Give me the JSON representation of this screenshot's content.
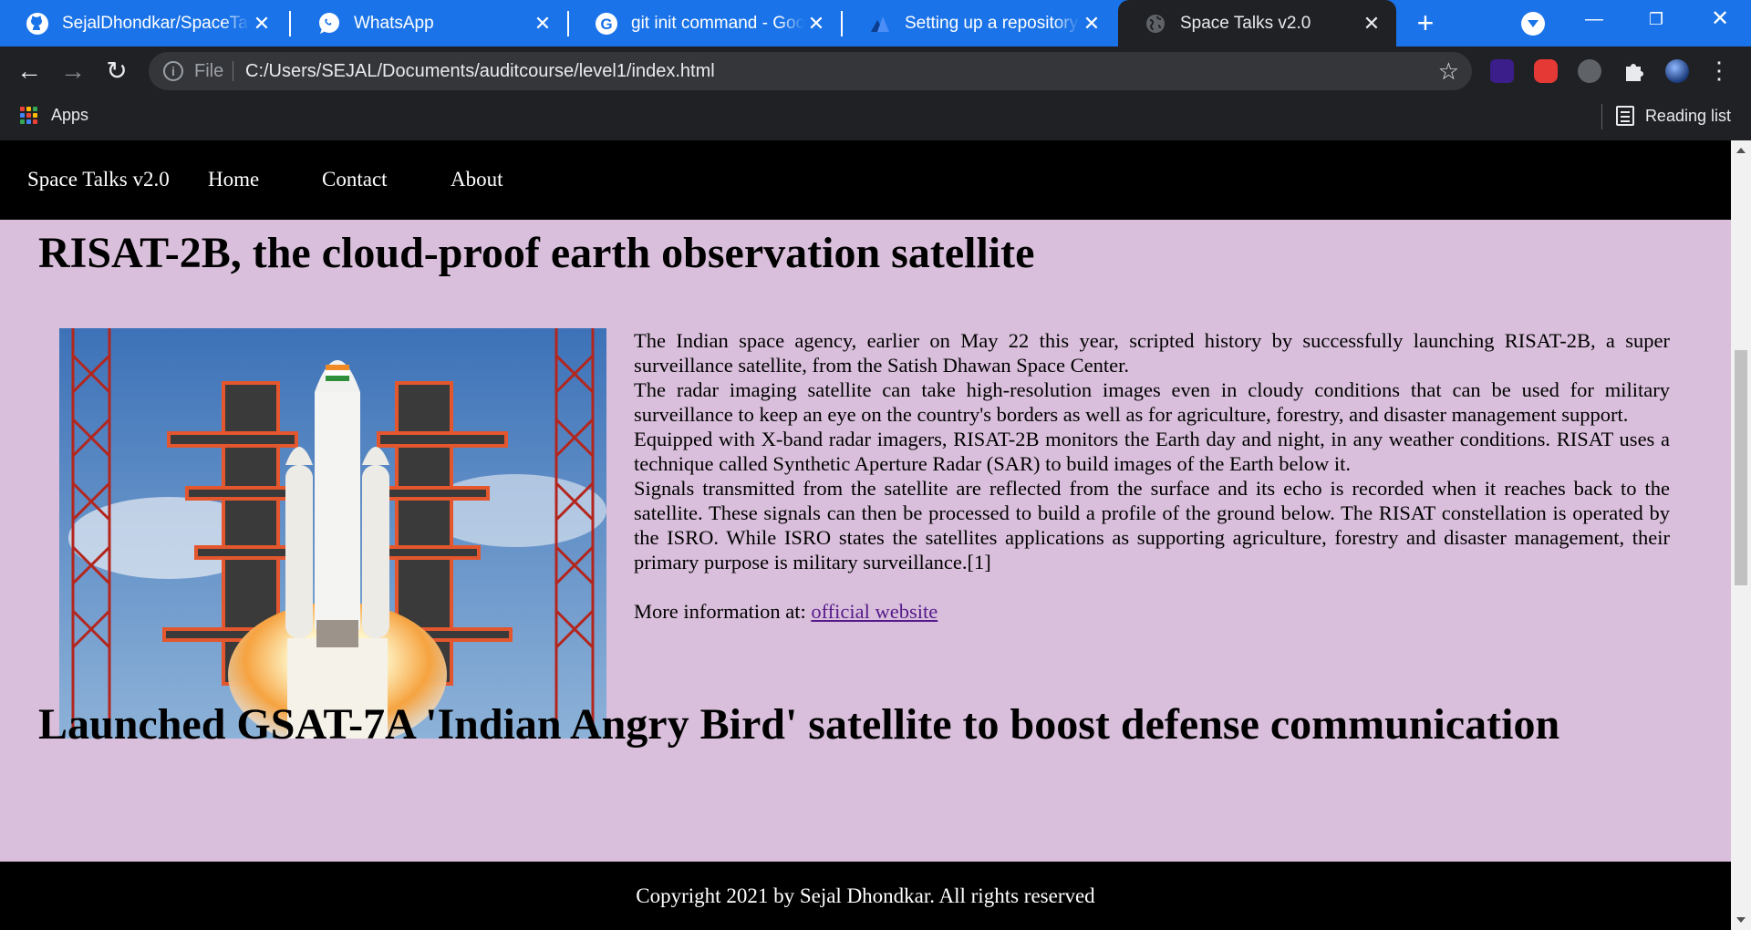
{
  "browser": {
    "tabs": [
      {
        "title": "SejalDhondkar/SpaceTalks",
        "icon": "github-icon"
      },
      {
        "title": "WhatsApp",
        "icon": "whatsapp-icon"
      },
      {
        "title": "git init command - Google Search",
        "icon": "google-icon"
      },
      {
        "title": "Setting up a repository | Atlassian",
        "icon": "atlassian-icon"
      },
      {
        "title": "Space Talks v2.0",
        "icon": "globe-icon",
        "active": true
      }
    ],
    "address": {
      "scheme": "File",
      "url": "C:/Users/SEJAL/Documents/auditcourse/level1/index.html"
    },
    "bookmarks": {
      "apps_label": "Apps",
      "reading_list_label": "Reading list"
    }
  },
  "site": {
    "nav": {
      "brand": "Space Talks v2.0",
      "items": [
        "Home",
        "Contact",
        "About"
      ]
    },
    "article1": {
      "heading": "RISAT-2B, the cloud-proof earth observation satellite",
      "paragraphs": [
        "The Indian space agency, earlier on May 22 this year, scripted history by successfully launching RISAT-2B, a super surveillance satellite, from the Satish Dhawan Space Center.",
        "The radar imaging satellite can take high-resolution images even in cloudy conditions that can be used for military surveillance to keep an eye on the country's borders as well as for agriculture, forestry, and disaster management support.",
        "Equipped with X-band radar imagers, RISAT-2B monitors the Earth day and night, in any weather conditions. RISAT uses a technique called Synthetic Aperture Radar (SAR) to build images of the Earth below it.",
        "Signals transmitted from the satellite are reflected from the surface and its echo is recorded when it reaches back to the satellite. These signals can then be processed to build a profile of the ground below. The RISAT constellation is operated by the ISRO. While ISRO states the satellites applications as supporting agriculture, forestry and disaster management, their primary purpose is military surveillance.[1]"
      ],
      "more_prefix": "More information at: ",
      "more_link": "official website"
    },
    "article2": {
      "heading": "Launched GSAT-7A 'Indian Angry Bird' satellite to boost defense communication"
    },
    "footer": "Copyright 2021 by Sejal Dhondkar. All rights reserved"
  },
  "colors": {
    "tab_strip": "#1a73e8",
    "chrome_dark": "#202124",
    "page_bg": "#d9bfdb",
    "link_visited": "#551a8b"
  }
}
